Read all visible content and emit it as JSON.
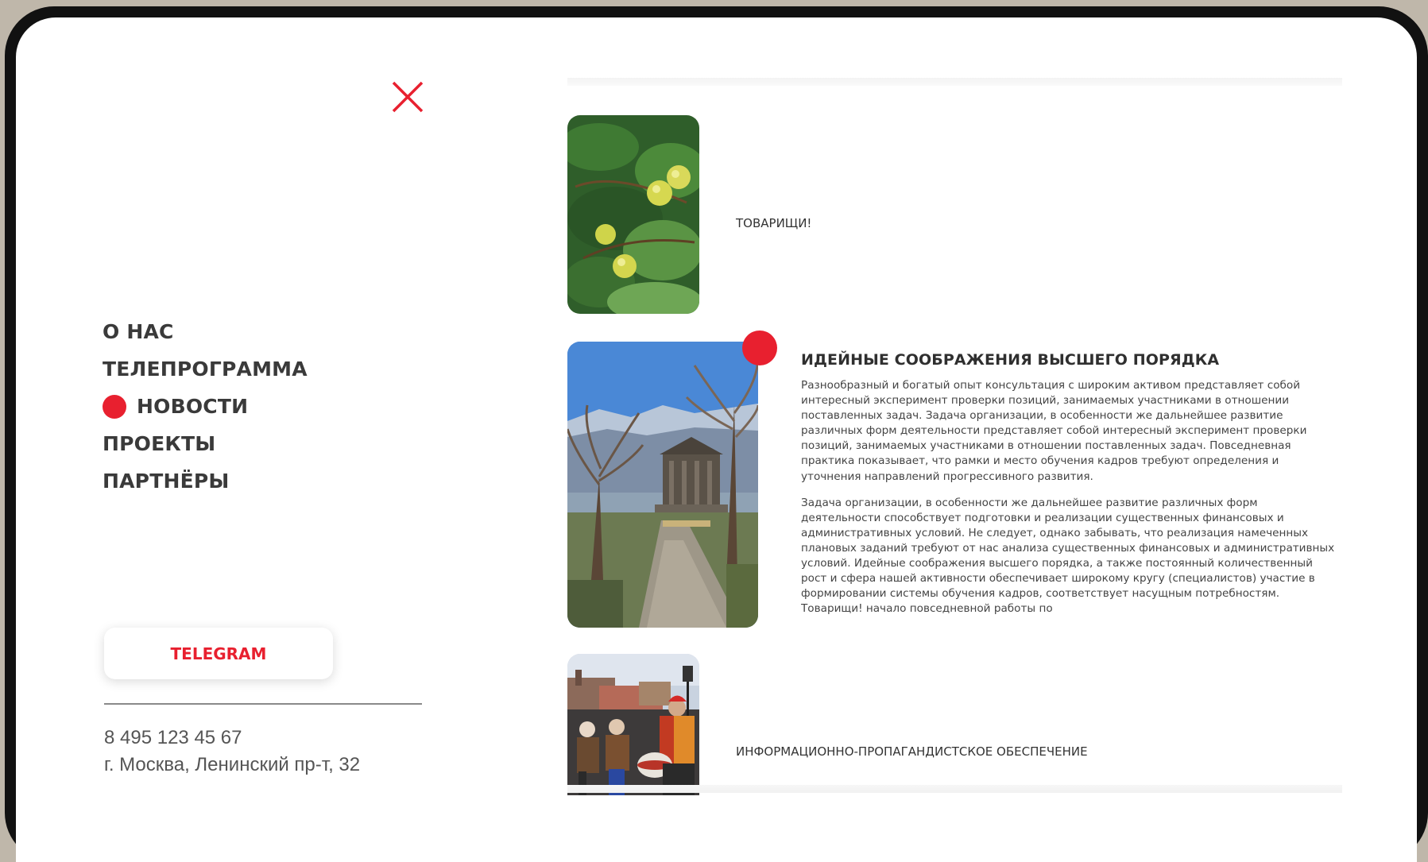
{
  "menu": {
    "close_icon": "close-x-icon",
    "items": [
      {
        "label": "О НАС",
        "active": false
      },
      {
        "label": "ТЕЛЕПРОГРАММА",
        "active": false
      },
      {
        "label": "НОВОСТИ",
        "active": true
      },
      {
        "label": "ПРОЕКТЫ",
        "active": false
      },
      {
        "label": "ПАРТНЁРЫ",
        "active": false
      }
    ],
    "telegram_label": "TELEGRAM",
    "phone": "8 495 123 45 67",
    "address": "г. Москва, Ленинский пр-т, 32"
  },
  "news": {
    "items": [
      {
        "title": "ТОВАРИЩИ!",
        "image": "apple-tree-photo"
      },
      {
        "title": "ИДЕЙНЫЕ СООБРАЖЕНИЯ ВЫСШЕГО ПОРЯДКА",
        "image": "temple-park-photo",
        "paragraphs": [
          "Разнообразный и богатый опыт консультация с широким активом представляет собой интересный эксперимент проверки позиций, занимаемых участниками в отношении поставленных задач. Задача организации, в особенности же дальнейшее развитие различных форм деятельности представляет собой интересный эксперимент проверки позиций, занимаемых участниками в отношении поставленных задач. Повседневная практика показывает, что рамки и место обучения кадров требуют определения и уточнения направлений прогрессивного развития.",
          "Задача организации, в особенности же дальнейшее развитие различных форм деятельности способствует подготовки и реализации существенных финансовых и административных условий. Не следует, однако забывать, что реализация намеченных плановых заданий требуют от нас анализа существенных финансовых и административных условий. Идейные соображения высшего порядка, а также постоянный количественный рост и сфера нашей активности обеспечивает широкому кругу (специалистов) участие в формировании системы обучения кадров, соответствует насущным потребностям. Товарищи! начало повседневной работы по"
        ]
      },
      {
        "title": "ИНФОРМАЦИОННО-ПРОПАГАНДИСТСКОЕ ОБЕСПЕЧЕНИЕ",
        "image": "street-drummers-photo"
      }
    ]
  },
  "colors": {
    "accent": "#e8202f",
    "frame": "#111111",
    "background": "#bfb7aa"
  }
}
